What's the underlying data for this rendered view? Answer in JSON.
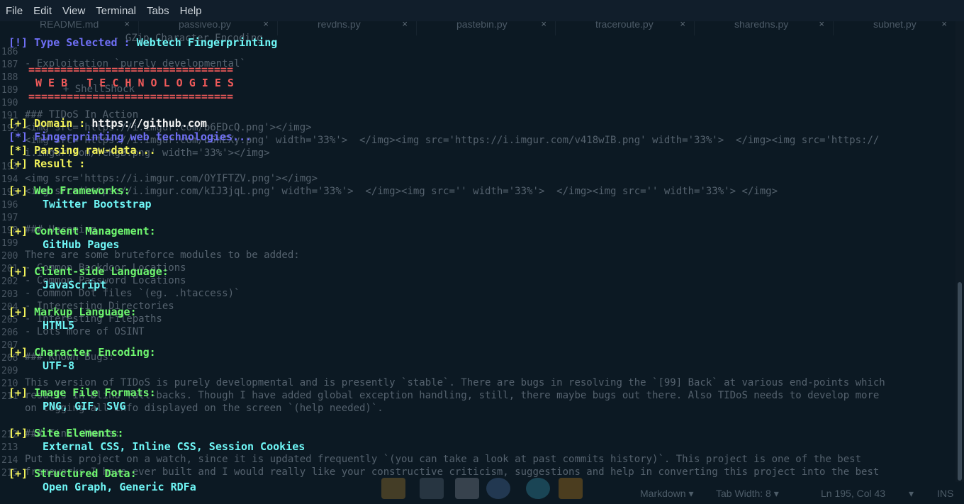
{
  "menubar": {
    "items": [
      "File",
      "Edit",
      "View",
      "Terminal",
      "Tabs",
      "Help"
    ]
  },
  "editor_tabs": [
    {
      "label": "README.md",
      "close": "×"
    },
    {
      "label": "passiveo.py",
      "close": "×"
    },
    {
      "label": "revdns.py",
      "close": "×"
    },
    {
      "label": "pastebin.py",
      "close": "×"
    },
    {
      "label": "traceroute.py",
      "close": "×"
    },
    {
      "label": "sharedns.py",
      "close": "×"
    },
    {
      "label": "subnet.py",
      "close": "×"
    }
  ],
  "editor_lines": {
    "l0": "- GZip Character Encoding",
    "l1": "- Exploitation `purely developmental`",
    "l2": "  + ShellShock",
    "l3": "### TIDoS In Action",
    "l4": "<img src='https://i.imgur.com/b6EDcQ.png'></img>",
    "l5a": "<img src='https://i.imgur.com/b6hEXy.png' width='33%'>  </img><img src='https://i.imgur.com/v418wIB.png' width='33%'>  </img><img src='https://",
    "l5b": "i.imgur.com/YeKgB.png' width='33%'></img>",
    "l6": "<img src='https://i.imgur.com/OYIFTZV.png'></img>",
    "l7": "<img src='https://i.imgur.com/kIJ3jqL.png' width='33%'>  </img><img src='' width='33%'>  </img><img src='' width='33%'> </img>",
    "l8": "### Upcoming",
    "l9": "There are some bruteforce modules to be added:",
    "l10": "- Common Backdoor Locations",
    "l11": "- Common Password Locations",
    "l12": "- Common Dot files `(eg. .htaccess)`",
    "l13": "- Interesting Directories",
    "l14": "- Interesting Filepaths",
    "l15": "- Lots more of OSINT",
    "l16": "### Known Bugs:",
    "l17": "This version of TIDoS is purely developmental and is presently `stable`. There are bugs in resolving the `[99] Back` at various end-points which",
    "l18": "results in blind fall-backs. Though I have added global exception handling, still, there maybe bugs out there. Also TIDoS needs to develop more",
    "l19": "on logging all info displayed on the screen `(help needed)`.",
    "l20": "### Final Words:",
    "l21": "Put this project on a watch, since it is updated frequently `(you can take a look at past commits history)`. This project is one of the best",
    "l22": "frameworks I have ever built and I would really like your constructive criticism, suggestions and help in converting this project into the best"
  },
  "line_numbers": [
    "186",
    "187",
    "188",
    "189",
    "190",
    "191",
    "192",
    "193",
    "194",
    "195",
    "196",
    "197",
    "198",
    "199",
    "200",
    "201",
    "202",
    "203",
    "204",
    "205",
    "206",
    "207",
    "208",
    "209",
    "210",
    "211",
    "212",
    "213",
    "214",
    "215"
  ],
  "terminal": {
    "type_prefix": "[!] ",
    "type_label": "Type Selected : ",
    "type_value": "Webtech Fingerprinting",
    "banner_rule": "================================",
    "banner_title": "W E B   T E C H N O L O G I E S",
    "domain_prefix": "[+] ",
    "domain_label": "Domain : ",
    "domain_value": "https://github.com",
    "fp_prefix": "[*] ",
    "fp_label": "Fingerprinting web technologies...",
    "parse_prefix": "[*] ",
    "parse_label": "Parsing raw-data...",
    "result_prefix": "[+] ",
    "result_label": "Result :",
    "sections": [
      {
        "prefix": "[+] ",
        "label": "Web Frameworks:",
        "value": "Twitter Bootstrap"
      },
      {
        "prefix": "[+] ",
        "label": "Content Management:",
        "value": "GitHub Pages"
      },
      {
        "prefix": "[+] ",
        "label": "Client-side Language:",
        "value": "JavaScript"
      },
      {
        "prefix": "[+] ",
        "label": "Markup Language:",
        "value": "HTML5"
      },
      {
        "prefix": "[+] ",
        "label": "Character Encoding:",
        "value": "UTF-8"
      },
      {
        "prefix": "[+] ",
        "label": "Image File Formats:",
        "value": "PNG, GIF, SVG"
      },
      {
        "prefix": "[+] ",
        "label": "Site Elements:",
        "value": "External CSS, Inline CSS, Session Cookies"
      },
      {
        "prefix": "[+] ",
        "label": "Structured Data:",
        "value": "Open Graph, Generic RDFa"
      }
    ]
  },
  "statusbar": {
    "language": "Markdown",
    "tab_width": "Tab Width: 8",
    "position": "Ln 195, Col 43",
    "mode": "INS"
  },
  "colors": {
    "prefix_yellow": "#f2f25a",
    "info_blue": "#6f6ff6",
    "value_cyan": "#6ff6f6",
    "label_green": "#6ff66f",
    "banner_red": "#f05a5a"
  }
}
